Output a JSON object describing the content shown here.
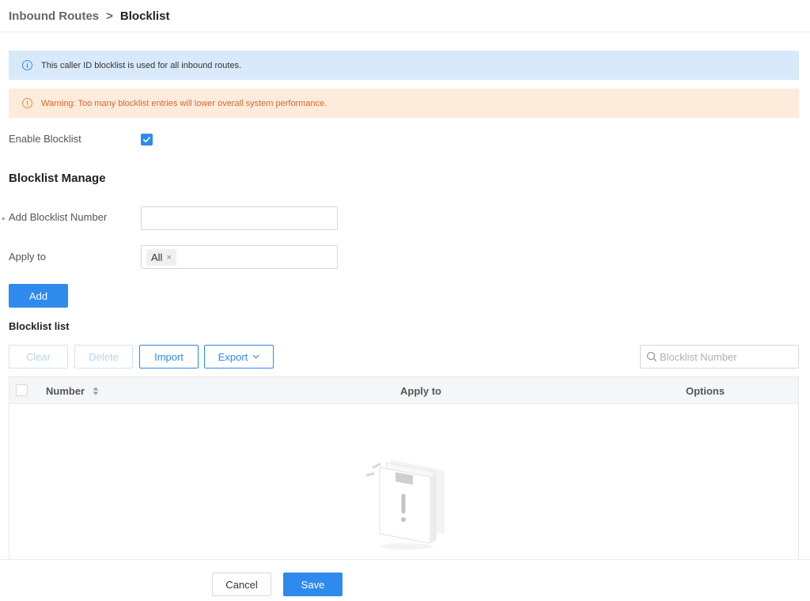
{
  "breadcrumb": {
    "parent": "Inbound Routes",
    "separator": ">",
    "current": "Blocklist"
  },
  "alerts": {
    "info": "This caller ID blocklist is used for all inbound routes.",
    "warning": "Warning: Too many blocklist entries will lower overall system performance."
  },
  "enable_blocklist": {
    "label": "Enable Blocklist",
    "checked": true
  },
  "manage": {
    "title": "Blocklist Manage",
    "add_number_label": "Add Blocklist Number",
    "add_number_value": "",
    "apply_to_label": "Apply to",
    "apply_to_tags": [
      "All"
    ],
    "add_button": "Add"
  },
  "list": {
    "title": "Blocklist list",
    "toolbar": {
      "clear": "Clear",
      "delete": "Delete",
      "import": "Import",
      "export": "Export"
    },
    "search_placeholder": "Blocklist Number",
    "columns": [
      "Number",
      "Apply to",
      "Options"
    ],
    "rows": []
  },
  "footer": {
    "cancel": "Cancel",
    "save": "Save"
  },
  "colors": {
    "accent": "#2e8aed",
    "info_bg": "#d9e9fc",
    "warning_bg": "#fdecdc",
    "warning_text": "#e0662a",
    "required": "#e53935"
  },
  "icons": [
    "info-icon",
    "warning-icon",
    "check-icon",
    "close-icon",
    "chevron-down-icon",
    "search-icon",
    "sort-icon",
    "empty-state-icon"
  ]
}
